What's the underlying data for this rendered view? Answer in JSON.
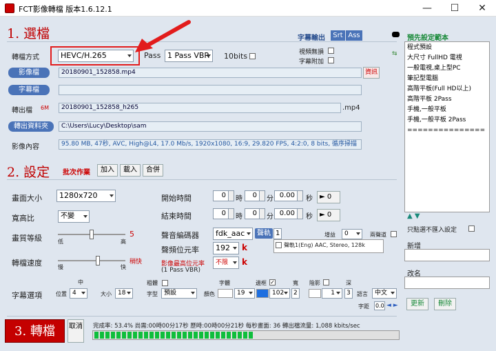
{
  "window": {
    "title": "FCT影像轉檔 版本1.6.12.1",
    "minimize": "—",
    "maximize": "☐",
    "close": "✕"
  },
  "section1": {
    "title": "1. 選檔",
    "subtitle_output": "字幕輸出",
    "srt": "Srt",
    "ass": "Ass",
    "format_label": "轉檔方式",
    "format_value": "HEVC/H.265",
    "pass_label": "Pass",
    "pass_value": "1 Pass VBR",
    "bits_label": "10bits",
    "video_no_loss_label": "視頻無損",
    "subtitle_attach_label": "字幕附加",
    "video_file_button": "影像檔",
    "video_file_value": "20180901_152858.mp4",
    "info_button": "資訊",
    "subtitle_file_button": "字幕檔",
    "subtitle_file_value": "",
    "output_file_label": "轉出檔",
    "output_size": "6M",
    "output_file_value": "20180901_152858_h265",
    "output_ext": ".mp4",
    "output_folder_button": "轉出資料夾",
    "output_folder_value": "C:\\Users\\Lucy\\Desktop\\sam",
    "content_label": "影像內容",
    "content_value": "95.80 MB, 47秒, AVC, High@L4, 17.0 Mb/s, 1920x1080, 16:9, 29.820 FPS, 4:2:0, 8 bits, 循序掃描"
  },
  "section2": {
    "title": "2. 設定",
    "batch_label": "批次作業",
    "add_button": "加入",
    "load_button": "載入",
    "merge_button": "合併",
    "size_label": "畫面大小",
    "size_value": "1280x720",
    "aspect_label": "寬高比",
    "aspect_value": "不變",
    "quality_label": "畫質等級",
    "quality_low": "低",
    "quality_high": "高",
    "quality_value": "5",
    "quality_level": 0.5,
    "speed_label": "轉檔速度",
    "speed_slow": "慢",
    "speed_fast": "快",
    "speed_value": "稍快",
    "speed_level": 0.6,
    "start_label": "開始時間",
    "end_label": "結束時間",
    "hour": "時",
    "minute": "分",
    "second": "秒",
    "zero": "0",
    "sec_zero": "0.00",
    "goto_zero": "► 0",
    "audio_codec_label": "聲音編碼器",
    "audio_codec_value": "fdk_aac",
    "track_label": "聲軌",
    "track_value": "1",
    "gain_label": "增益",
    "gain_value": "0",
    "two_ch_label": "兩聲道",
    "audio_bitrate_label": "聲頻位元率",
    "audio_bitrate_value": "192",
    "kbps_unit": "k",
    "track_item": "聲軌1(Eng) AAC, Stereo, 128k",
    "video_max_label": "影像最高位元率",
    "video_max_value": "不限",
    "video_max_note": "(1 Pass VBR)",
    "subtitle_opt_label": "字幕選項",
    "mid_label": "中",
    "position_label": "位置",
    "position_value": "4",
    "size_small_label": "大小",
    "size_small_value": "18",
    "bold_label": "粗體",
    "font_label": "字型",
    "font_value": "預設",
    "char_label": "字體",
    "color_label": "顏色",
    "color_value": "19",
    "border_label": "邊框",
    "border_value": "102",
    "width_label": "寬",
    "width_value": "2",
    "shadow_label": "陰影",
    "shadow_value": "1",
    "depth_label": "深",
    "depth_value": "3",
    "lang_label": "語言",
    "lang_value": "中文",
    "spacing_label": "字距",
    "spacing_value": "0.0"
  },
  "section3": {
    "convert_button": "3. 轉檔",
    "cancel_button": "取消",
    "status": "完成率: 53.4% 尚需:00時00分17秒 歷時:00時00分21秒 每秒畫面: 36 轉出檔流量: 1,088 kbits/sec",
    "progress": 0.534
  },
  "right_panel": {
    "title": "預先設定範本",
    "presets": [
      "程式預設",
      "大尺寸 FullHD 電視",
      "一般電視,桌上型PC",
      "筆記型電腦",
      "高階平板(Full HD以上)",
      "高階平板 2Pass",
      "手機,一般平板",
      "手機,一般平板  2Pass",
      "==============="
    ],
    "no_load_label": "只點選不匯入設定",
    "new_label": "新增",
    "rename_label": "改名",
    "update_button": "更新",
    "delete_button": "刪除"
  },
  "colors": {
    "accent_red": "#c00000",
    "pill_blue": "#4a73b8",
    "progress_green": "#0fbe3c"
  }
}
